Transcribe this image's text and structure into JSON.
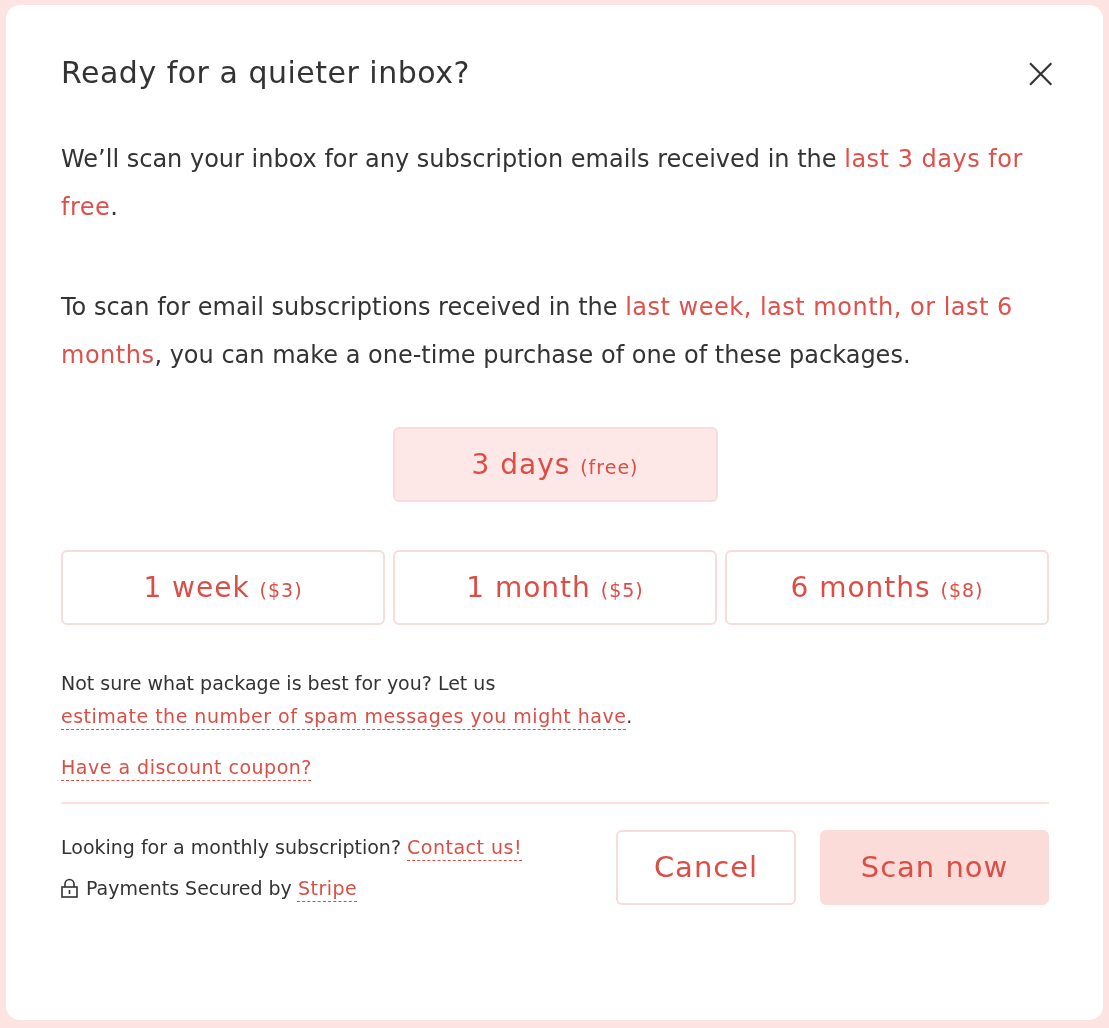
{
  "dialog": {
    "title": "Ready for a quieter inbox?",
    "close": "×"
  },
  "paragraphs": [
    {
      "segments": [
        {
          "text": "We’ll scan your inbox for any subscription emails received in the ",
          "highlight": false
        },
        {
          "text": "last 3 days for free",
          "highlight": true
        },
        {
          "text": ".",
          "highlight": false
        }
      ]
    },
    {
      "segments": [
        {
          "text": "To scan for email subscriptions received in the ",
          "highlight": false
        },
        {
          "text": "last week, last month, or last 6 months",
          "highlight": true
        },
        {
          "text": ", you can make a one-time purchase of one of these packages.",
          "highlight": false
        }
      ]
    }
  ],
  "package_rows": [
    {
      "packages": [
        {
          "label": "3 days",
          "price": "(free)",
          "selected": true
        }
      ]
    },
    {
      "packages": [
        {
          "label": "1 week",
          "price": "($3)",
          "selected": false
        },
        {
          "label": "1 month",
          "price": "($5)",
          "selected": false
        },
        {
          "label": "6 months",
          "price": "($8)",
          "selected": false
        }
      ]
    }
  ],
  "estimate": {
    "text": "Not sure what package is best for you? Let us ",
    "link": "estimate the number of spam messages you might have",
    "after": "."
  },
  "coupon_link": "Have a discount coupon?",
  "footer": {
    "monthly": "Looking for a monthly subscription? ",
    "contact_link": "Contact us!",
    "secured": "Payments Secured by ",
    "stripe_link": "Stripe"
  },
  "buttons": [
    {
      "label": "Cancel",
      "kind": "secondary"
    },
    {
      "label": "Scan now",
      "kind": "primary"
    }
  ]
}
